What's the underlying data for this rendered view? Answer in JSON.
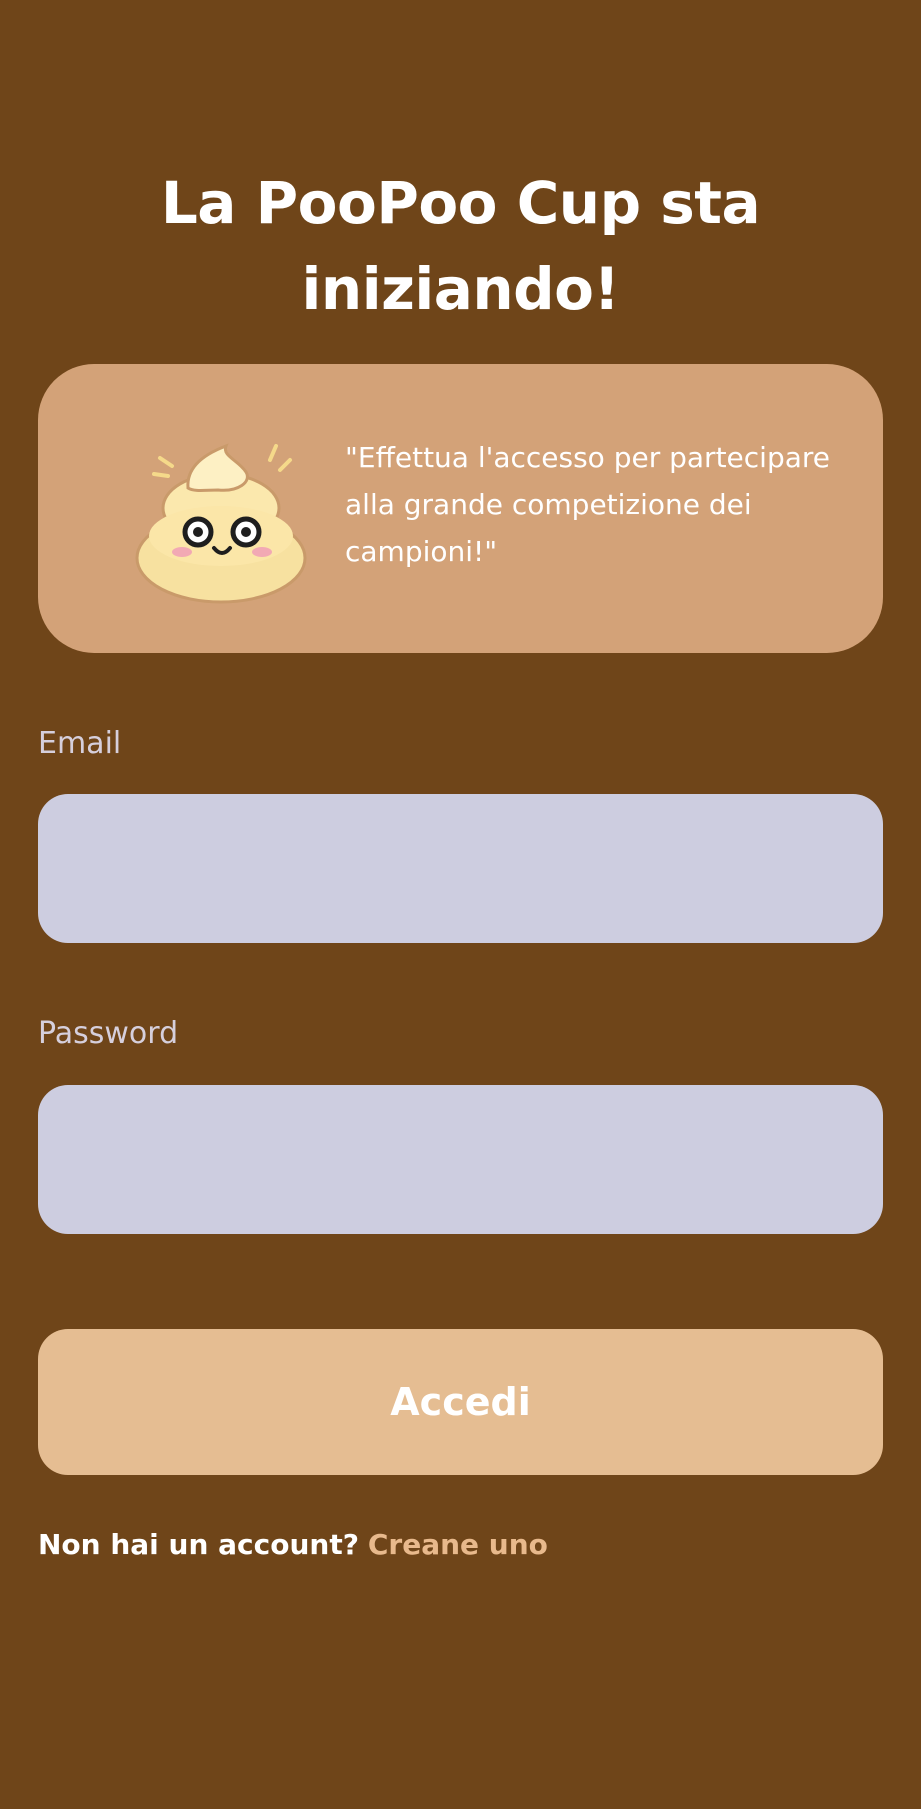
{
  "header": {
    "title": "La PooPoo Cup sta iniziando!"
  },
  "banner": {
    "mascot_icon": "poop-mascot-icon",
    "message": "\"Effettua l'accesso per partecipare alla grande competizione dei campioni!\""
  },
  "form": {
    "email_label": "Email",
    "email_value": "",
    "password_label": "Password",
    "password_value": "",
    "submit_label": "Accedi"
  },
  "footer": {
    "prompt": "Non hai un account?",
    "link_label": "Creane uno"
  },
  "colors": {
    "background": "#6f4519",
    "banner": "#d3a278",
    "input": "#cdcde0",
    "button": "#e5bd92",
    "link": "#e8b98c"
  }
}
